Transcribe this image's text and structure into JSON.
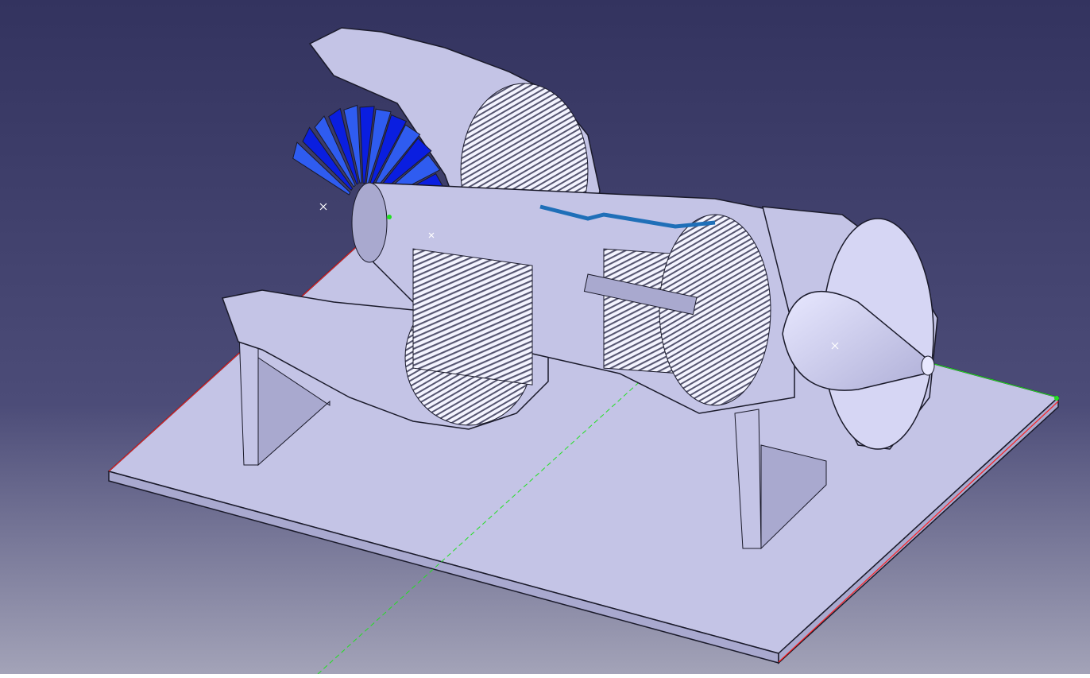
{
  "viewport": {
    "background_top": "#33335f",
    "background_mid": "#4c4c78",
    "background_bottom": "#a3a3b8"
  },
  "model": {
    "part_color": "#c4c4e6",
    "part_shade": "#a9a9cf",
    "edge_color": "#1a1a2a",
    "fan_blade_color": "#0a1ee0",
    "fan_blade_light": "#2f5cf0",
    "accent_blue": "#1f6fb8",
    "axis_x_color": "#ff2020",
    "axis_y_color": "#22e022"
  }
}
